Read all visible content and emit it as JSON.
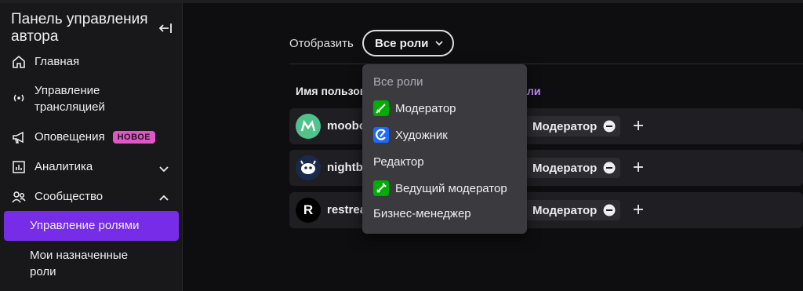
{
  "sidebar": {
    "title": "Панель управления автора",
    "collapse_icon": "collapse-left-icon",
    "items": [
      {
        "label": "Главная",
        "icon": "home-icon"
      },
      {
        "label": "Управление трансляцией",
        "icon": "broadcast-icon"
      },
      {
        "label": "Оповещения",
        "icon": "megaphone-icon",
        "badge": "НОВОЕ"
      },
      {
        "label": "Аналитика",
        "icon": "analytics-icon",
        "expanded": false
      },
      {
        "label": "Сообщество",
        "icon": "community-icon",
        "expanded": true
      }
    ],
    "subitems": [
      {
        "label": "Управление ролями",
        "active": true
      },
      {
        "label": "Мои назначенные роли",
        "active": false
      }
    ],
    "colors": {
      "active": "#772ce8",
      "badge": "#e255c8"
    }
  },
  "filter": {
    "label": "Отобразить",
    "selected": "Все роли"
  },
  "table": {
    "col_user": "Имя пользователя",
    "col_roles": "ли",
    "rows": [
      {
        "username": "moobot",
        "visible_name": "moobo",
        "role": "Модератор",
        "avatar_letter": "",
        "avatar_color": "#4fc38a"
      },
      {
        "username": "nightbot",
        "visible_name": "nightb",
        "role": "Модератор",
        "avatar_letter": "",
        "avatar_color": "#1b2a4a"
      },
      {
        "username": "restream",
        "visible_name": "restrea",
        "role": "Модератор",
        "avatar_letter": "R",
        "avatar_color": "#000000"
      }
    ]
  },
  "dropdown": {
    "items": [
      {
        "label": "Все роли",
        "icon": "",
        "muted": true
      },
      {
        "label": "Модератор",
        "icon": "sword-icon",
        "color": "#00ad03"
      },
      {
        "label": "Художник",
        "icon": "brush-icon",
        "color": "#1e69ff"
      },
      {
        "label": "Редактор",
        "icon": ""
      },
      {
        "label": "Ведущий модератор",
        "icon": "wrench-sword-icon",
        "color": "#00ad03"
      },
      {
        "label": "Бизнес-менеджер",
        "icon": ""
      }
    ]
  }
}
